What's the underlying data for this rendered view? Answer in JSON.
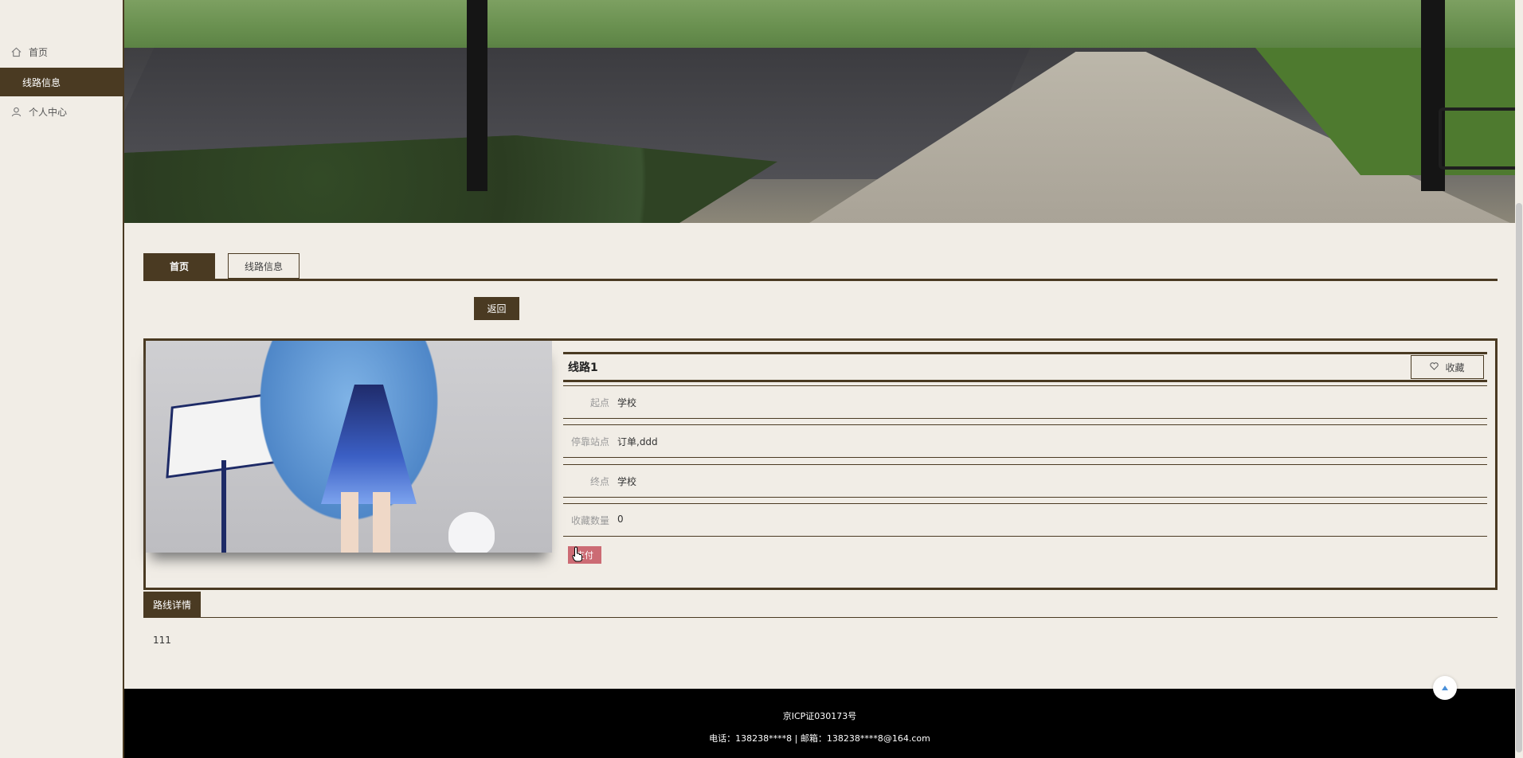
{
  "sidebar": {
    "items": [
      {
        "label": "首页",
        "icon": "home-icon"
      },
      {
        "label": "线路信息",
        "icon": "route-icon",
        "active": true
      },
      {
        "label": "个人中心",
        "icon": "user-icon"
      }
    ]
  },
  "tabs": [
    {
      "label": "首页",
      "active": true
    },
    {
      "label": "线路信息"
    }
  ],
  "back_label": "返回",
  "route": {
    "title": "线路1",
    "favorite_label": "收藏",
    "fields": [
      {
        "key": "起点",
        "value": "学校"
      },
      {
        "key": "停靠站点",
        "value": "订单,ddd"
      },
      {
        "key": "终点",
        "value": "学校"
      },
      {
        "key": "收藏数量",
        "value": "0"
      }
    ],
    "pay_label": "支付"
  },
  "detail": {
    "tab_label": "路线详情",
    "text": "111"
  },
  "footer": {
    "icp": "京ICP证030173号",
    "contact": "电话：138238****8 | 邮箱：138238****8@164.com"
  },
  "colors": {
    "accent": "#4a3a22",
    "background": "#f1ede6",
    "pay_button": "#cc6b74"
  }
}
